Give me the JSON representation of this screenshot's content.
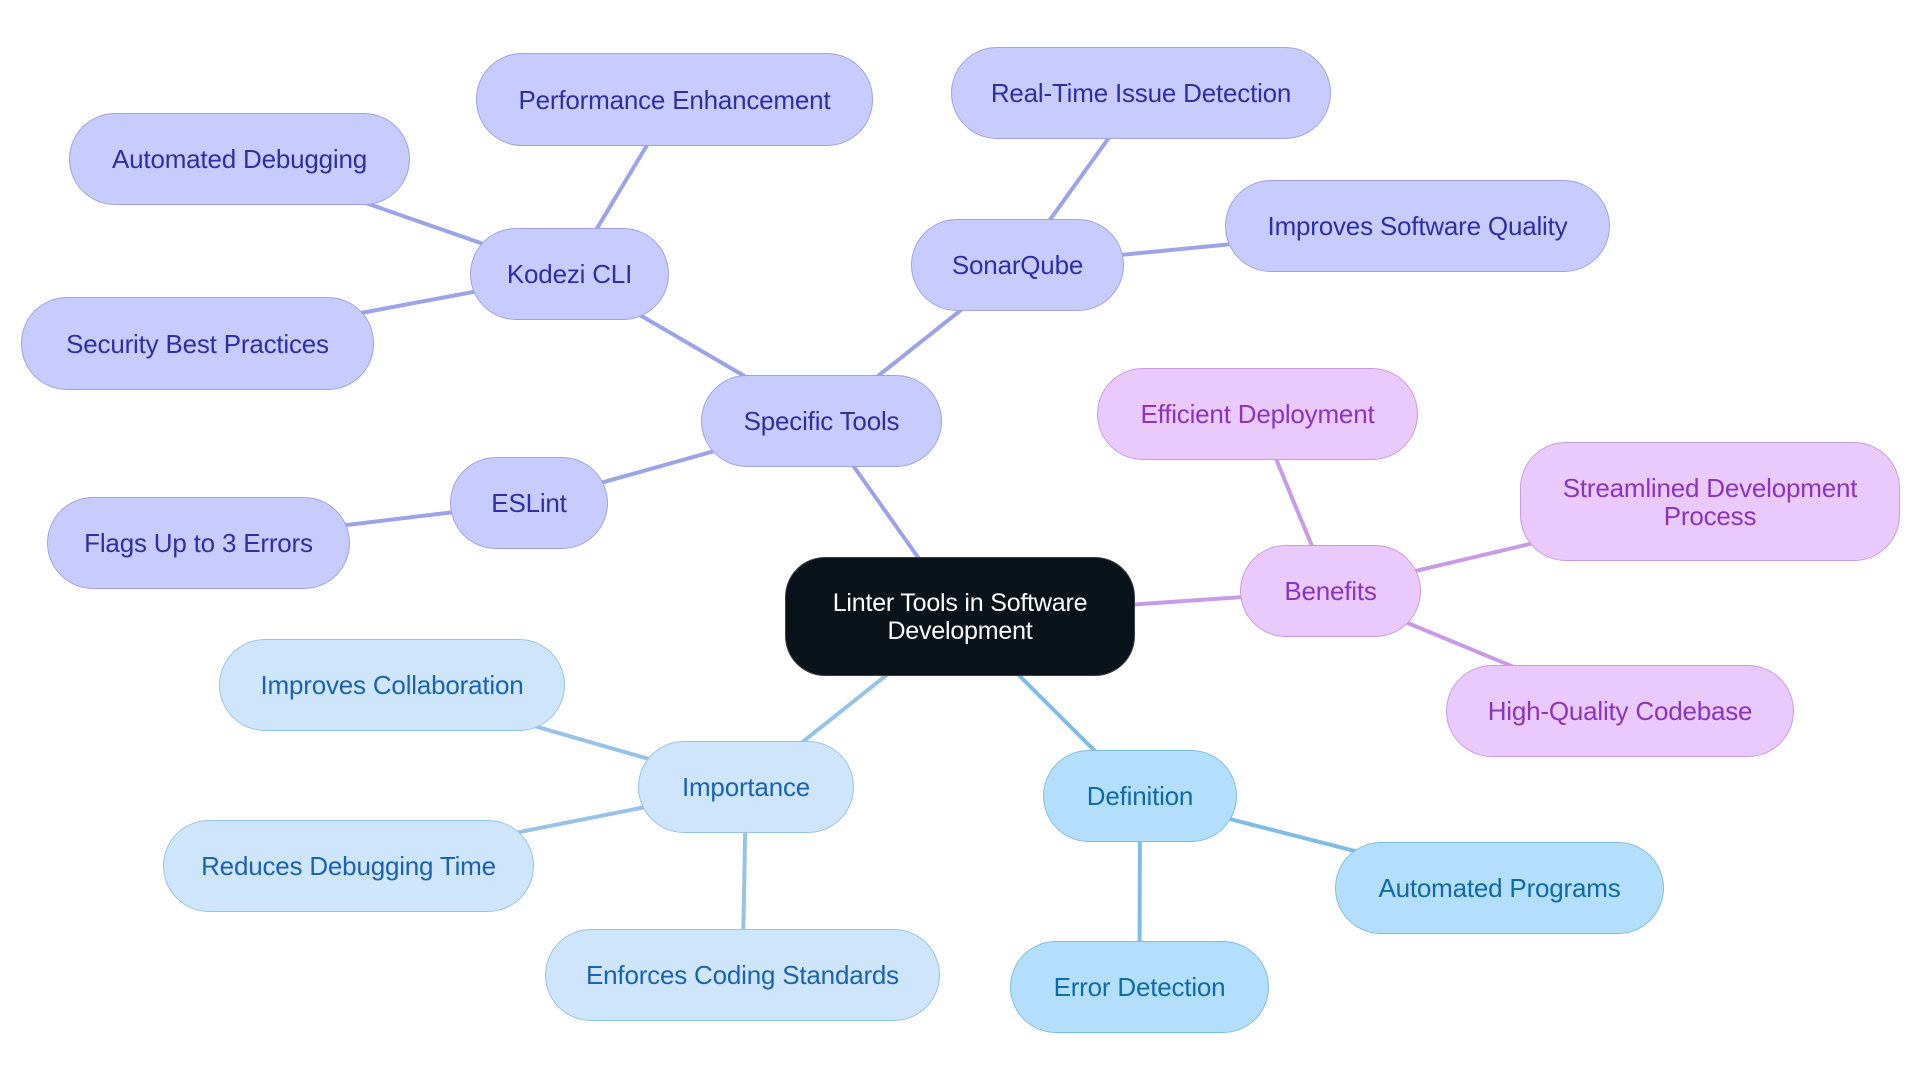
{
  "diagram": {
    "type": "mind-map",
    "root": {
      "id": "root",
      "label": "Linter Tools in Software Development"
    },
    "colors": {
      "root_fill": "#0b131a",
      "tools_fill": "#c7cbfd",
      "tools_edge": "#9da3e8",
      "tools_text": "#2e2fa5",
      "benefits_fill": "#eac9fc",
      "benefits_edge": "#c99be6",
      "benefits_text": "#8a34c0",
      "definition_fill": "#b3dffc",
      "definition_edge": "#7ebde6",
      "definition_text": "#0f6aa8",
      "importance_fill": "#cfe5fc",
      "importance_edge": "#98c3e8",
      "importance_text": "#1b63b0"
    },
    "nodes": {
      "root": "Linter Tools in Software Development",
      "specific_tools": "Specific Tools",
      "kodezi_cli": "Kodezi CLI",
      "performance_enhancement": "Performance Enhancement",
      "automated_debugging": "Automated Debugging",
      "security_best_practices": "Security Best Practices",
      "sonarqube": "SonarQube",
      "real_time_issue_detection": "Real-Time Issue Detection",
      "improves_software_quality": "Improves Software Quality",
      "eslint": "ESLint",
      "flags_up_to_3_errors": "Flags Up to 3 Errors",
      "benefits": "Benefits",
      "efficient_deployment": "Efficient Deployment",
      "streamlined_development_process": "Streamlined Development Process",
      "high_quality_codebase": "High-Quality Codebase",
      "definition": "Definition",
      "automated_programs": "Automated Programs",
      "error_detection": "Error Detection",
      "importance": "Importance",
      "improves_collaboration": "Improves Collaboration",
      "reduces_debugging_time": "Reduces Debugging Time",
      "enforces_coding_standards": "Enforces Coding Standards"
    },
    "edges": [
      [
        "root",
        "specific_tools"
      ],
      [
        "root",
        "benefits"
      ],
      [
        "root",
        "definition"
      ],
      [
        "root",
        "importance"
      ],
      [
        "specific_tools",
        "kodezi_cli"
      ],
      [
        "specific_tools",
        "sonarqube"
      ],
      [
        "specific_tools",
        "eslint"
      ],
      [
        "kodezi_cli",
        "performance_enhancement"
      ],
      [
        "kodezi_cli",
        "automated_debugging"
      ],
      [
        "kodezi_cli",
        "security_best_practices"
      ],
      [
        "sonarqube",
        "real_time_issue_detection"
      ],
      [
        "sonarqube",
        "improves_software_quality"
      ],
      [
        "eslint",
        "flags_up_to_3_errors"
      ],
      [
        "benefits",
        "efficient_deployment"
      ],
      [
        "benefits",
        "streamlined_development_process"
      ],
      [
        "benefits",
        "high_quality_codebase"
      ],
      [
        "definition",
        "automated_programs"
      ],
      [
        "definition",
        "error_detection"
      ],
      [
        "importance",
        "improves_collaboration"
      ],
      [
        "importance",
        "reduces_debugging_time"
      ],
      [
        "importance",
        "enforces_coding_standards"
      ]
    ]
  }
}
